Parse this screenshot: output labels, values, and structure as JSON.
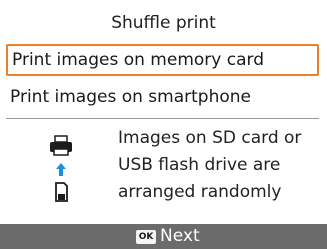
{
  "screen": {
    "title": "Shuffle print",
    "menu": [
      {
        "label": "Print images on memory card",
        "selected": true
      },
      {
        "label": "Print images on smartphone",
        "selected": false
      }
    ],
    "info": {
      "icons": [
        "printer-icon",
        "up-arrow-icon",
        "memory-card-icon"
      ],
      "description_lines": [
        "Images on SD card or",
        "USB flash drive are",
        "arranged randomly"
      ]
    },
    "footer": {
      "ok_badge": "OK",
      "next_label": "Next"
    },
    "colors": {
      "selection_border": "#ec7f2a",
      "footer_bg": "#6b6b6b",
      "icon_blue": "#1e8fe0"
    }
  }
}
